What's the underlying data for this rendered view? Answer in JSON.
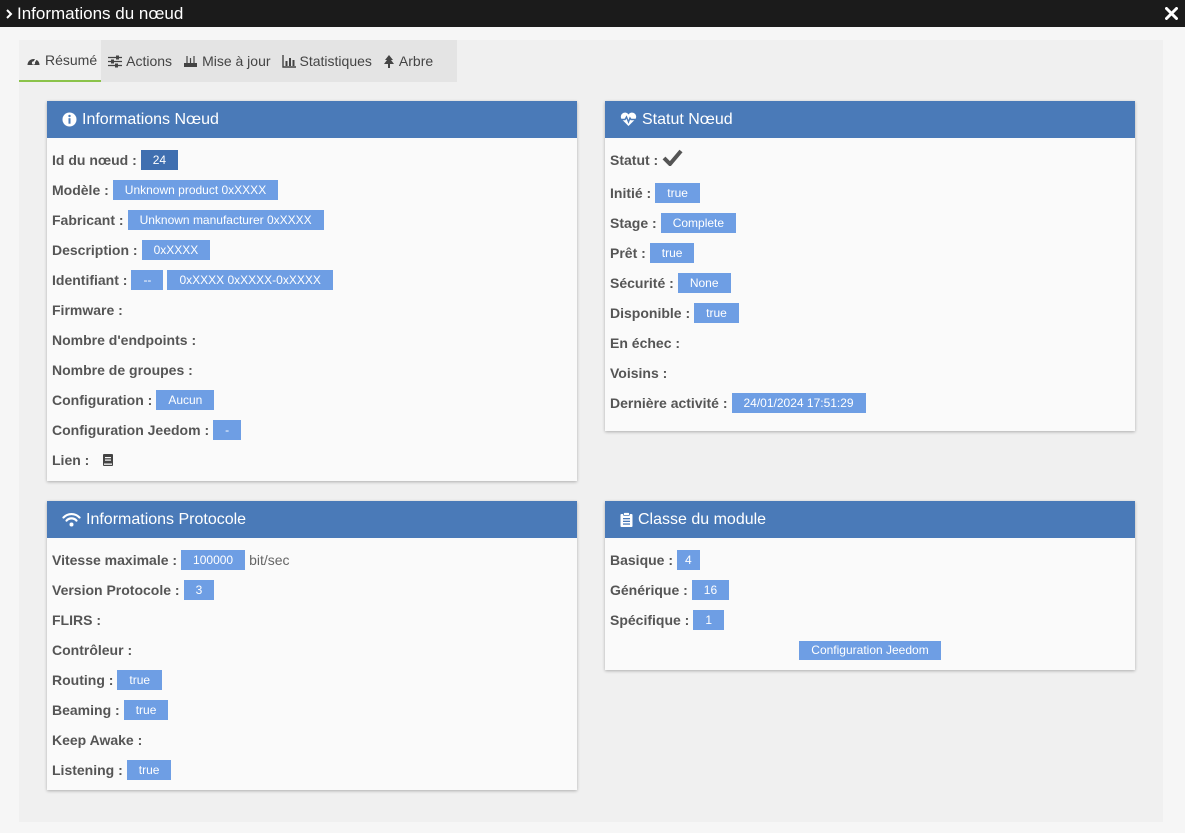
{
  "window": {
    "title": "Informations du nœud"
  },
  "tabs": [
    {
      "label": "Résumé"
    },
    {
      "label": "Actions"
    },
    {
      "label": "Mise à jour"
    },
    {
      "label": "Statistiques"
    },
    {
      "label": "Arbre"
    }
  ],
  "colors": {
    "panel_header": "#4a7ab8",
    "badge": "#6e9ee4",
    "active_tab_border": "#8bc34a",
    "titlebar": "#1b1b1b"
  },
  "node_info": {
    "title": "Informations Nœud",
    "id": {
      "label": "Id du nœud :",
      "value": "24"
    },
    "model": {
      "label": "Modèle :",
      "value": "Unknown product 0xXXXX"
    },
    "manufacturer": {
      "label": "Fabricant :",
      "value": "Unknown manufacturer 0xXXXX"
    },
    "description": {
      "label": "Description :",
      "value": "0xXXXX"
    },
    "identifier": {
      "label": "Identifiant :",
      "value1": "--",
      "value2": "0xXXXX 0xXXXX-0xXXXX"
    },
    "firmware": {
      "label": "Firmware :"
    },
    "endpoints": {
      "label": "Nombre d'endpoints :"
    },
    "groups": {
      "label": "Nombre de groupes :"
    },
    "configuration": {
      "label": "Configuration :",
      "value": "Aucun"
    },
    "jeedom_config": {
      "label": "Configuration Jeedom :",
      "value": "-"
    },
    "link": {
      "label": "Lien :",
      "icon": "book-icon"
    }
  },
  "node_status": {
    "title": "Statut Nœud",
    "status": {
      "label": "Statut :",
      "icon": "check-icon"
    },
    "initiated": {
      "label": "Initié :",
      "value": "true"
    },
    "stage": {
      "label": "Stage :",
      "value": "Complete"
    },
    "ready": {
      "label": "Prêt :",
      "value": "true"
    },
    "security": {
      "label": "Sécurité :",
      "value": "None"
    },
    "available": {
      "label": "Disponible :",
      "value": "true"
    },
    "failed": {
      "label": "En échec :"
    },
    "neighbors": {
      "label": "Voisins :"
    },
    "last_activity": {
      "label": "Dernière activité :",
      "value": "24/01/2024 17:51:29"
    }
  },
  "protocol_info": {
    "title": "Informations Protocole",
    "max_speed": {
      "label": "Vitesse maximale :",
      "value": "100000",
      "unit": "bit/sec"
    },
    "version": {
      "label": "Version Protocole :",
      "value": "3"
    },
    "flirs": {
      "label": "FLIRS :"
    },
    "controller": {
      "label": "Contrôleur :"
    },
    "routing": {
      "label": "Routing :",
      "value": "true"
    },
    "beaming": {
      "label": "Beaming :",
      "value": "true"
    },
    "keep_awake": {
      "label": "Keep Awake :"
    },
    "listening": {
      "label": "Listening :",
      "value": "true"
    }
  },
  "module_class": {
    "title": "Classe du module",
    "basic": {
      "label": "Basique :",
      "value": "4"
    },
    "generic": {
      "label": "Générique :",
      "value": "16"
    },
    "specific": {
      "label": "Spécifique :",
      "value": "1"
    },
    "button_label": "Configuration Jeedom"
  }
}
